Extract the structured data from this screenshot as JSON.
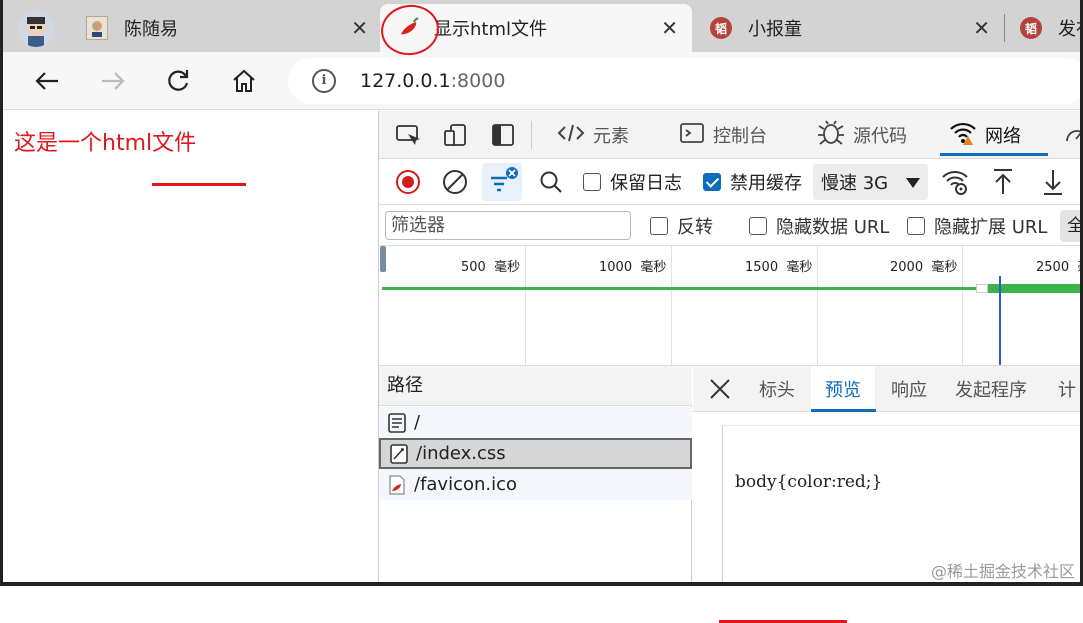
{
  "tabs": [
    {
      "title": "陈随易",
      "favicon": "avatar-icon",
      "active": false
    },
    {
      "title": "显示html文件",
      "favicon": "chili-pepper-icon",
      "active": true
    },
    {
      "title": "小报童",
      "favicon": "badge-icon",
      "favicon_text": "韬",
      "active": false
    },
    {
      "title": "发布",
      "favicon": "badge-icon",
      "favicon_text": "韬",
      "active": false
    }
  ],
  "address_bar": {
    "host": "127.0.0.1",
    "port": ":8000",
    "info": "i"
  },
  "page": {
    "text": "这是一个html文件"
  },
  "devtools": {
    "tabs": [
      {
        "label": "元素",
        "icon": "code-icon"
      },
      {
        "label": "控制台",
        "icon": "console-icon"
      },
      {
        "label": "源代码",
        "icon": "bug-icon"
      },
      {
        "label": "网络",
        "icon": "wifi-icon",
        "active": true
      }
    ],
    "network_toolbar": {
      "preserve_log": "保留日志",
      "disable_cache": "禁用缓存",
      "throttle": "慢速 3G"
    },
    "filter": {
      "placeholder": "筛选器",
      "invert": "反转",
      "hide_data_urls": "隐藏数据 URL",
      "hide_extension_urls": "隐藏扩展 URL",
      "all": "全"
    },
    "timeline": {
      "unit": "毫秒",
      "ticks": [
        "500",
        "1000",
        "1500",
        "2000",
        "2500"
      ]
    },
    "paths": {
      "header": "路径",
      "rows": [
        {
          "name": "/",
          "icon": "document-icon"
        },
        {
          "name": "/index.css",
          "icon": "css-file-icon",
          "selected": true
        },
        {
          "name": "/favicon.ico",
          "icon": "chili-pepper-icon"
        }
      ]
    },
    "detail": {
      "tabs": [
        "标头",
        "预览",
        "响应",
        "发起程序",
        "计"
      ],
      "active_tab": "预览",
      "preview_content": "body{color:red;}"
    }
  },
  "watermark": "@稀土掘金技术社区",
  "colors": {
    "accent": "#0f6cbd",
    "annotation": "#e0181b",
    "timeline_bar": "#3cb44b"
  }
}
